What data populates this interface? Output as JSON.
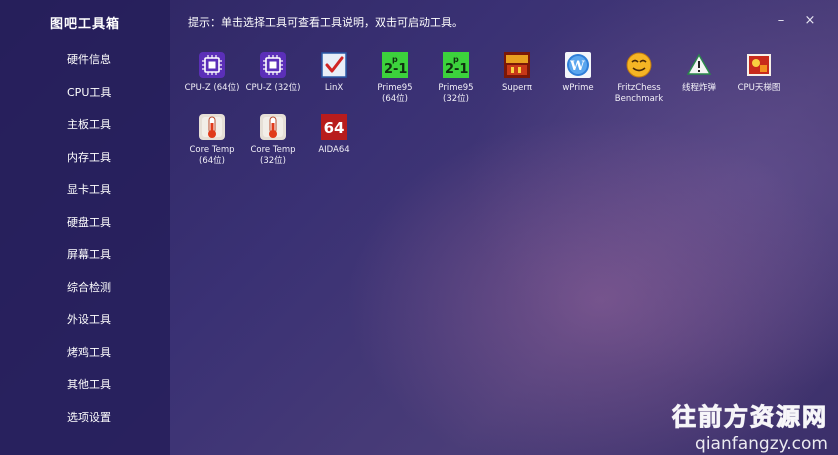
{
  "app": {
    "title": "图吧工具箱",
    "hint": "提示：单击选择工具可查看工具说明，双击可启动工具。",
    "minimize_glyph": "–",
    "close_glyph": "×"
  },
  "sidebar": {
    "items": [
      {
        "label": "硬件信息"
      },
      {
        "label": "CPU工具"
      },
      {
        "label": "主板工具"
      },
      {
        "label": "内存工具"
      },
      {
        "label": "显卡工具"
      },
      {
        "label": "硬盘工具"
      },
      {
        "label": "屏幕工具"
      },
      {
        "label": "综合检测"
      },
      {
        "label": "外设工具"
      },
      {
        "label": "烤鸡工具"
      },
      {
        "label": "其他工具"
      },
      {
        "label": "选项设置"
      }
    ]
  },
  "tools": [
    {
      "label": "CPU-Z (64位)",
      "icon": "cpu-chip-icon"
    },
    {
      "label": "CPU-Z (32位)",
      "icon": "cpu-chip-icon"
    },
    {
      "label": "LinX",
      "icon": "checkbox-icon"
    },
    {
      "label": "Prime95\n(64位)",
      "icon": "prime95-icon"
    },
    {
      "label": "Prime95\n(32位)",
      "icon": "prime95-icon"
    },
    {
      "label": "Superπ",
      "icon": "superpi-icon"
    },
    {
      "label": "wPrime",
      "icon": "wprime-icon"
    },
    {
      "label": "FritzChess\nBenchmark",
      "icon": "smiley-face-icon"
    },
    {
      "label": "线程炸弹",
      "icon": "warning-icon"
    },
    {
      "label": "CPU天梯图",
      "icon": "ladder-chart-icon"
    },
    {
      "label": "Core Temp\n(64位)",
      "icon": "thermometer-icon"
    },
    {
      "label": "Core Temp\n(32位)",
      "icon": "thermometer-icon"
    },
    {
      "label": "AIDA64",
      "icon": "aida64-icon",
      "icon_text": "64"
    }
  ],
  "watermark": {
    "line1": "往前方资源网",
    "line2": "qianfangzy.com"
  },
  "colors": {
    "sidebar_bg": "#261e5a",
    "accent_purple": "#6a3fc8",
    "prime_green": "#3cd23c",
    "aida_red": "#b81c1c"
  }
}
